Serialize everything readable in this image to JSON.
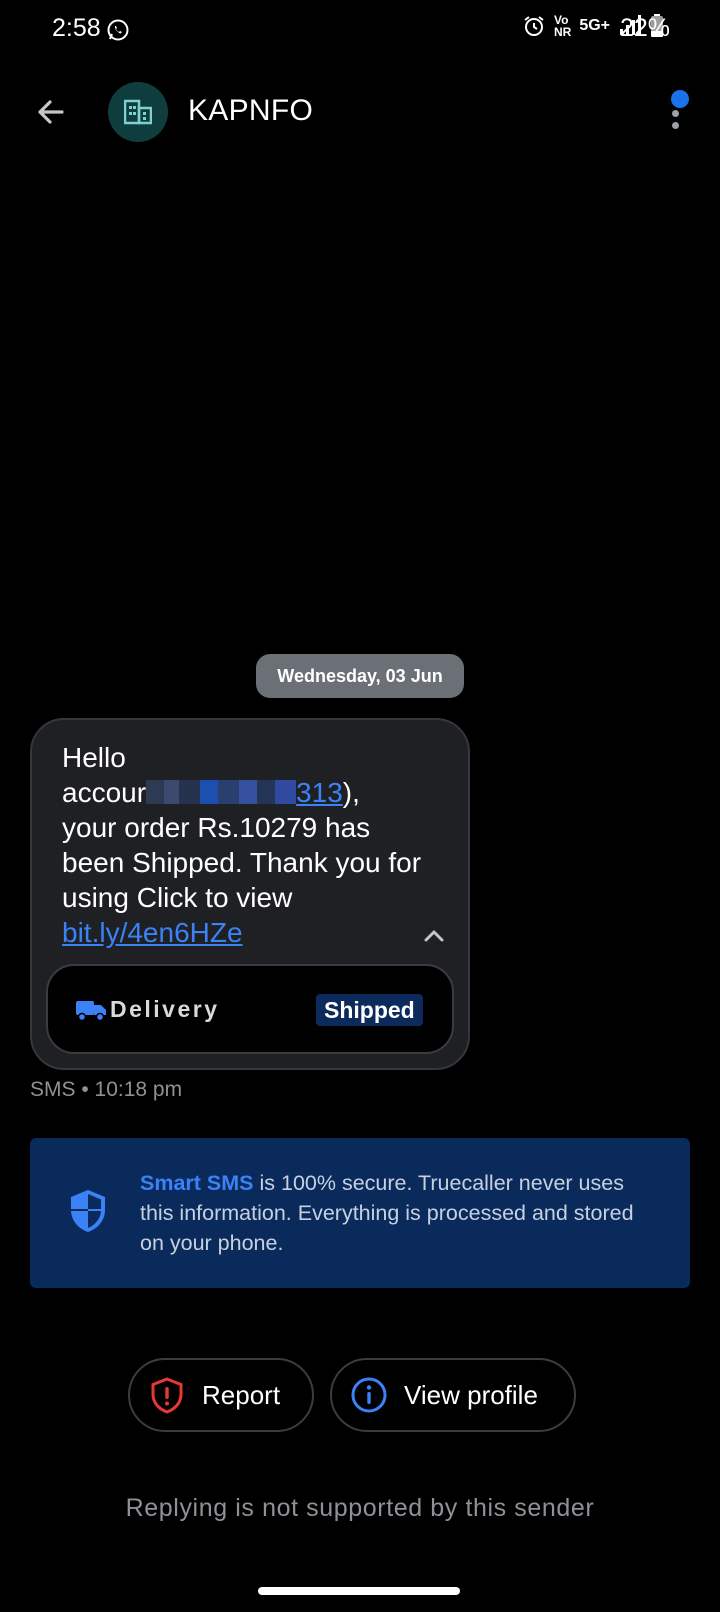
{
  "status_bar": {
    "time": "2:58",
    "network_vo": "Vo",
    "network_nr": "NR",
    "network_type": "5G+",
    "battery_percent": "22%"
  },
  "header": {
    "sender_name": "KAPNFO",
    "avatar_icon": "building-icon",
    "back_icon": "arrow-left-icon",
    "menu_icon": "more-vert-icon"
  },
  "conversation": {
    "date_chip": "Wednesday, 03 Jun",
    "message": {
      "line_hello": "Hello",
      "account_prefix": "accour",
      "account_suffix": "313",
      "account_close": "),",
      "body": "your order Rs.10279 has been Shipped. Thank you for using Click to view",
      "link": "bit.ly/4en6HZe",
      "delivery_label": "Delivery",
      "delivery_status": "Shipped",
      "meta": "SMS • 10:18 pm"
    }
  },
  "smart_banner": {
    "brand": "Smart SMS",
    "text": " is 100% secure. Truecaller never uses this information. Everything is processed and stored on your phone."
  },
  "actions": {
    "report_label": "Report",
    "view_profile_label": "View profile"
  },
  "reply_note": "Replying is not supported by this sender",
  "colors": {
    "accent_blue": "#3b82f6",
    "banner_bg": "#0b2a5c",
    "report_red": "#e53935"
  }
}
